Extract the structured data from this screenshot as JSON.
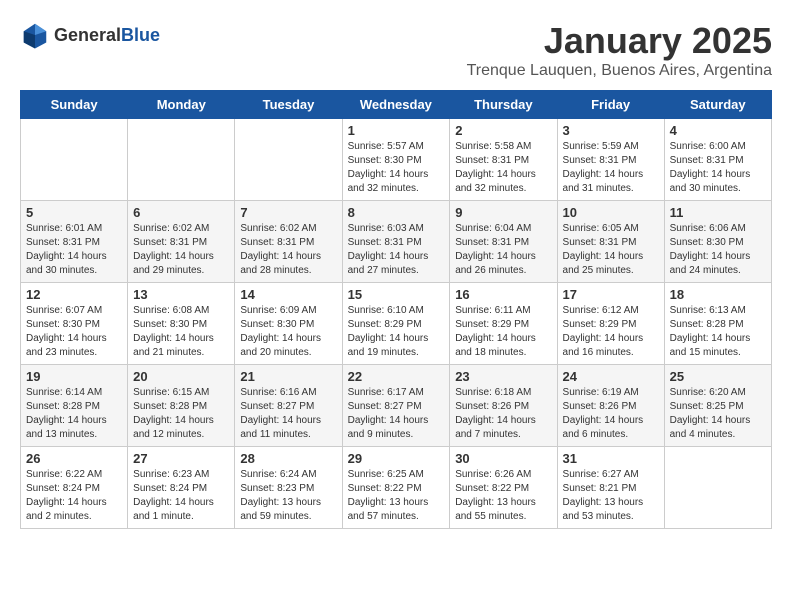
{
  "logo": {
    "general": "General",
    "blue": "Blue"
  },
  "header": {
    "month": "January 2025",
    "location": "Trenque Lauquen, Buenos Aires, Argentina"
  },
  "weekdays": [
    "Sunday",
    "Monday",
    "Tuesday",
    "Wednesday",
    "Thursday",
    "Friday",
    "Saturday"
  ],
  "weeks": [
    [
      {
        "day": "",
        "info": ""
      },
      {
        "day": "",
        "info": ""
      },
      {
        "day": "",
        "info": ""
      },
      {
        "day": "1",
        "info": "Sunrise: 5:57 AM\nSunset: 8:30 PM\nDaylight: 14 hours\nand 32 minutes."
      },
      {
        "day": "2",
        "info": "Sunrise: 5:58 AM\nSunset: 8:31 PM\nDaylight: 14 hours\nand 32 minutes."
      },
      {
        "day": "3",
        "info": "Sunrise: 5:59 AM\nSunset: 8:31 PM\nDaylight: 14 hours\nand 31 minutes."
      },
      {
        "day": "4",
        "info": "Sunrise: 6:00 AM\nSunset: 8:31 PM\nDaylight: 14 hours\nand 30 minutes."
      }
    ],
    [
      {
        "day": "5",
        "info": "Sunrise: 6:01 AM\nSunset: 8:31 PM\nDaylight: 14 hours\nand 30 minutes."
      },
      {
        "day": "6",
        "info": "Sunrise: 6:02 AM\nSunset: 8:31 PM\nDaylight: 14 hours\nand 29 minutes."
      },
      {
        "day": "7",
        "info": "Sunrise: 6:02 AM\nSunset: 8:31 PM\nDaylight: 14 hours\nand 28 minutes."
      },
      {
        "day": "8",
        "info": "Sunrise: 6:03 AM\nSunset: 8:31 PM\nDaylight: 14 hours\nand 27 minutes."
      },
      {
        "day": "9",
        "info": "Sunrise: 6:04 AM\nSunset: 8:31 PM\nDaylight: 14 hours\nand 26 minutes."
      },
      {
        "day": "10",
        "info": "Sunrise: 6:05 AM\nSunset: 8:31 PM\nDaylight: 14 hours\nand 25 minutes."
      },
      {
        "day": "11",
        "info": "Sunrise: 6:06 AM\nSunset: 8:30 PM\nDaylight: 14 hours\nand 24 minutes."
      }
    ],
    [
      {
        "day": "12",
        "info": "Sunrise: 6:07 AM\nSunset: 8:30 PM\nDaylight: 14 hours\nand 23 minutes."
      },
      {
        "day": "13",
        "info": "Sunrise: 6:08 AM\nSunset: 8:30 PM\nDaylight: 14 hours\nand 21 minutes."
      },
      {
        "day": "14",
        "info": "Sunrise: 6:09 AM\nSunset: 8:30 PM\nDaylight: 14 hours\nand 20 minutes."
      },
      {
        "day": "15",
        "info": "Sunrise: 6:10 AM\nSunset: 8:29 PM\nDaylight: 14 hours\nand 19 minutes."
      },
      {
        "day": "16",
        "info": "Sunrise: 6:11 AM\nSunset: 8:29 PM\nDaylight: 14 hours\nand 18 minutes."
      },
      {
        "day": "17",
        "info": "Sunrise: 6:12 AM\nSunset: 8:29 PM\nDaylight: 14 hours\nand 16 minutes."
      },
      {
        "day": "18",
        "info": "Sunrise: 6:13 AM\nSunset: 8:28 PM\nDaylight: 14 hours\nand 15 minutes."
      }
    ],
    [
      {
        "day": "19",
        "info": "Sunrise: 6:14 AM\nSunset: 8:28 PM\nDaylight: 14 hours\nand 13 minutes."
      },
      {
        "day": "20",
        "info": "Sunrise: 6:15 AM\nSunset: 8:28 PM\nDaylight: 14 hours\nand 12 minutes."
      },
      {
        "day": "21",
        "info": "Sunrise: 6:16 AM\nSunset: 8:27 PM\nDaylight: 14 hours\nand 11 minutes."
      },
      {
        "day": "22",
        "info": "Sunrise: 6:17 AM\nSunset: 8:27 PM\nDaylight: 14 hours\nand 9 minutes."
      },
      {
        "day": "23",
        "info": "Sunrise: 6:18 AM\nSunset: 8:26 PM\nDaylight: 14 hours\nand 7 minutes."
      },
      {
        "day": "24",
        "info": "Sunrise: 6:19 AM\nSunset: 8:26 PM\nDaylight: 14 hours\nand 6 minutes."
      },
      {
        "day": "25",
        "info": "Sunrise: 6:20 AM\nSunset: 8:25 PM\nDaylight: 14 hours\nand 4 minutes."
      }
    ],
    [
      {
        "day": "26",
        "info": "Sunrise: 6:22 AM\nSunset: 8:24 PM\nDaylight: 14 hours\nand 2 minutes."
      },
      {
        "day": "27",
        "info": "Sunrise: 6:23 AM\nSunset: 8:24 PM\nDaylight: 14 hours\nand 1 minute."
      },
      {
        "day": "28",
        "info": "Sunrise: 6:24 AM\nSunset: 8:23 PM\nDaylight: 13 hours\nand 59 minutes."
      },
      {
        "day": "29",
        "info": "Sunrise: 6:25 AM\nSunset: 8:22 PM\nDaylight: 13 hours\nand 57 minutes."
      },
      {
        "day": "30",
        "info": "Sunrise: 6:26 AM\nSunset: 8:22 PM\nDaylight: 13 hours\nand 55 minutes."
      },
      {
        "day": "31",
        "info": "Sunrise: 6:27 AM\nSunset: 8:21 PM\nDaylight: 13 hours\nand 53 minutes."
      },
      {
        "day": "",
        "info": ""
      }
    ]
  ]
}
